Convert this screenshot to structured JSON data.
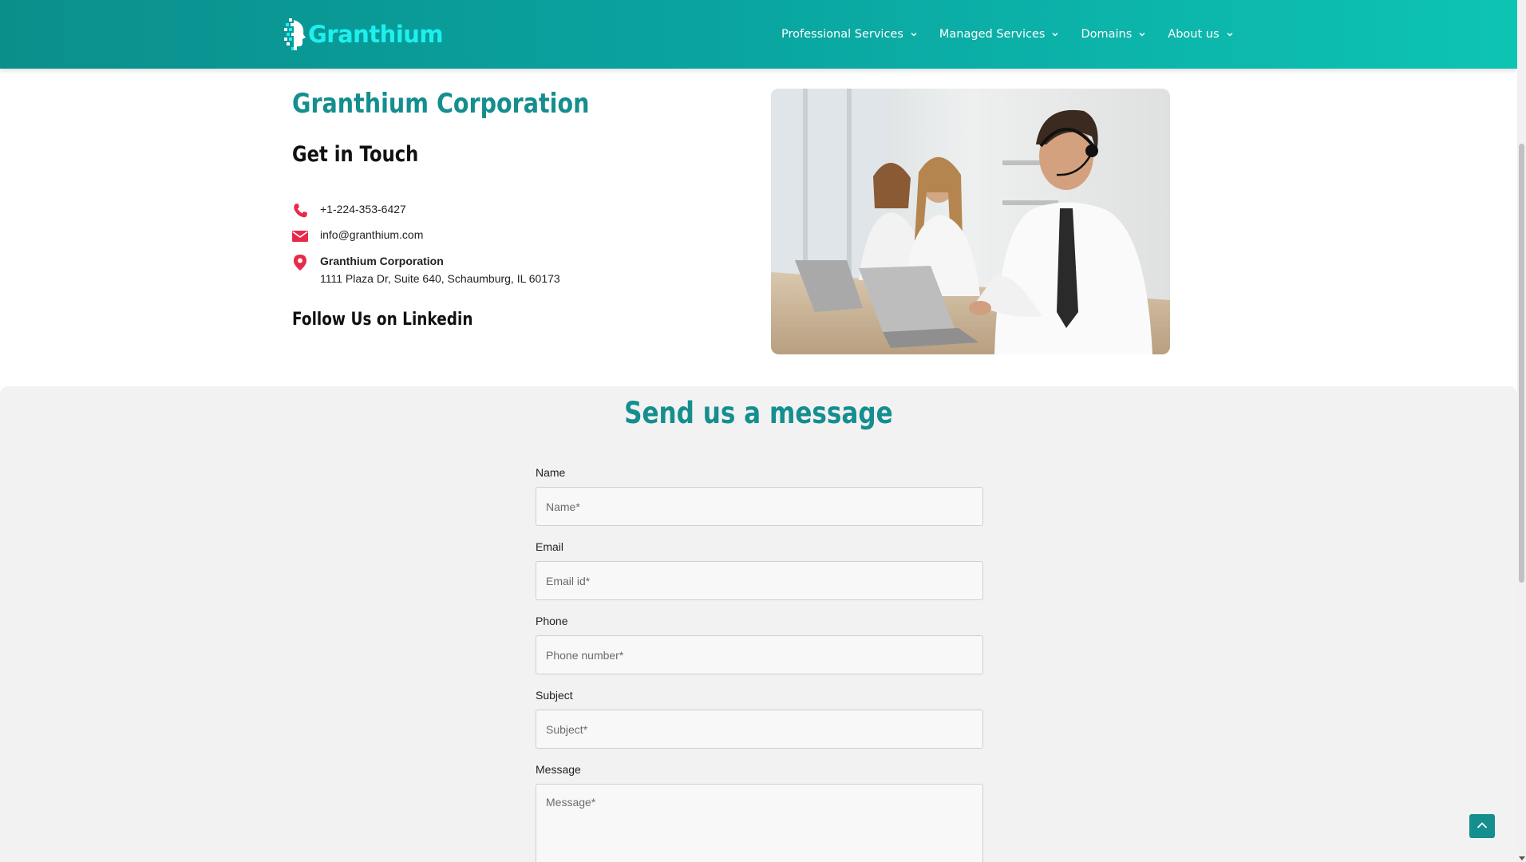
{
  "header": {
    "logo_text": "Granthium",
    "nav": [
      {
        "label": "Professional Services"
      },
      {
        "label": "Managed Services"
      },
      {
        "label": "Domains"
      },
      {
        "label": "About us"
      }
    ]
  },
  "contact": {
    "company_title": "Granthium Corporation",
    "get_in_touch": "Get in Touch",
    "phone": "+1-224-353-6427",
    "email": "info@granthium.com",
    "address_name": "Granthium Corporation",
    "address_line": "1111 Plaza Dr, Suite 640, Schaumburg, IL 60173",
    "follow_title": "Follow Us on Linkedin"
  },
  "form": {
    "title": "Send us a message",
    "name_label": "Name",
    "name_placeholder": "Name*",
    "email_label": "Email",
    "email_placeholder": "Email id*",
    "phone_label": "Phone",
    "phone_placeholder": "Phone number*",
    "subject_label": "Subject",
    "subject_placeholder": "Subject*",
    "message_label": "Message",
    "message_placeholder": "Message*"
  },
  "colors": {
    "brand_teal": "#148e8e",
    "header_gradient_start": "#0b8f8c",
    "header_gradient_end": "#0dc4b3",
    "logo_cyan": "#1ef0f0",
    "icon_red": "#e8294a",
    "section_gray": "#f2f2f2"
  },
  "icons": {
    "phone": "phone-icon",
    "email": "envelope-icon",
    "address": "map-pin-icon",
    "nav_dropdown": "chevron-down-icon",
    "back_to_top": "chevron-up-icon"
  }
}
